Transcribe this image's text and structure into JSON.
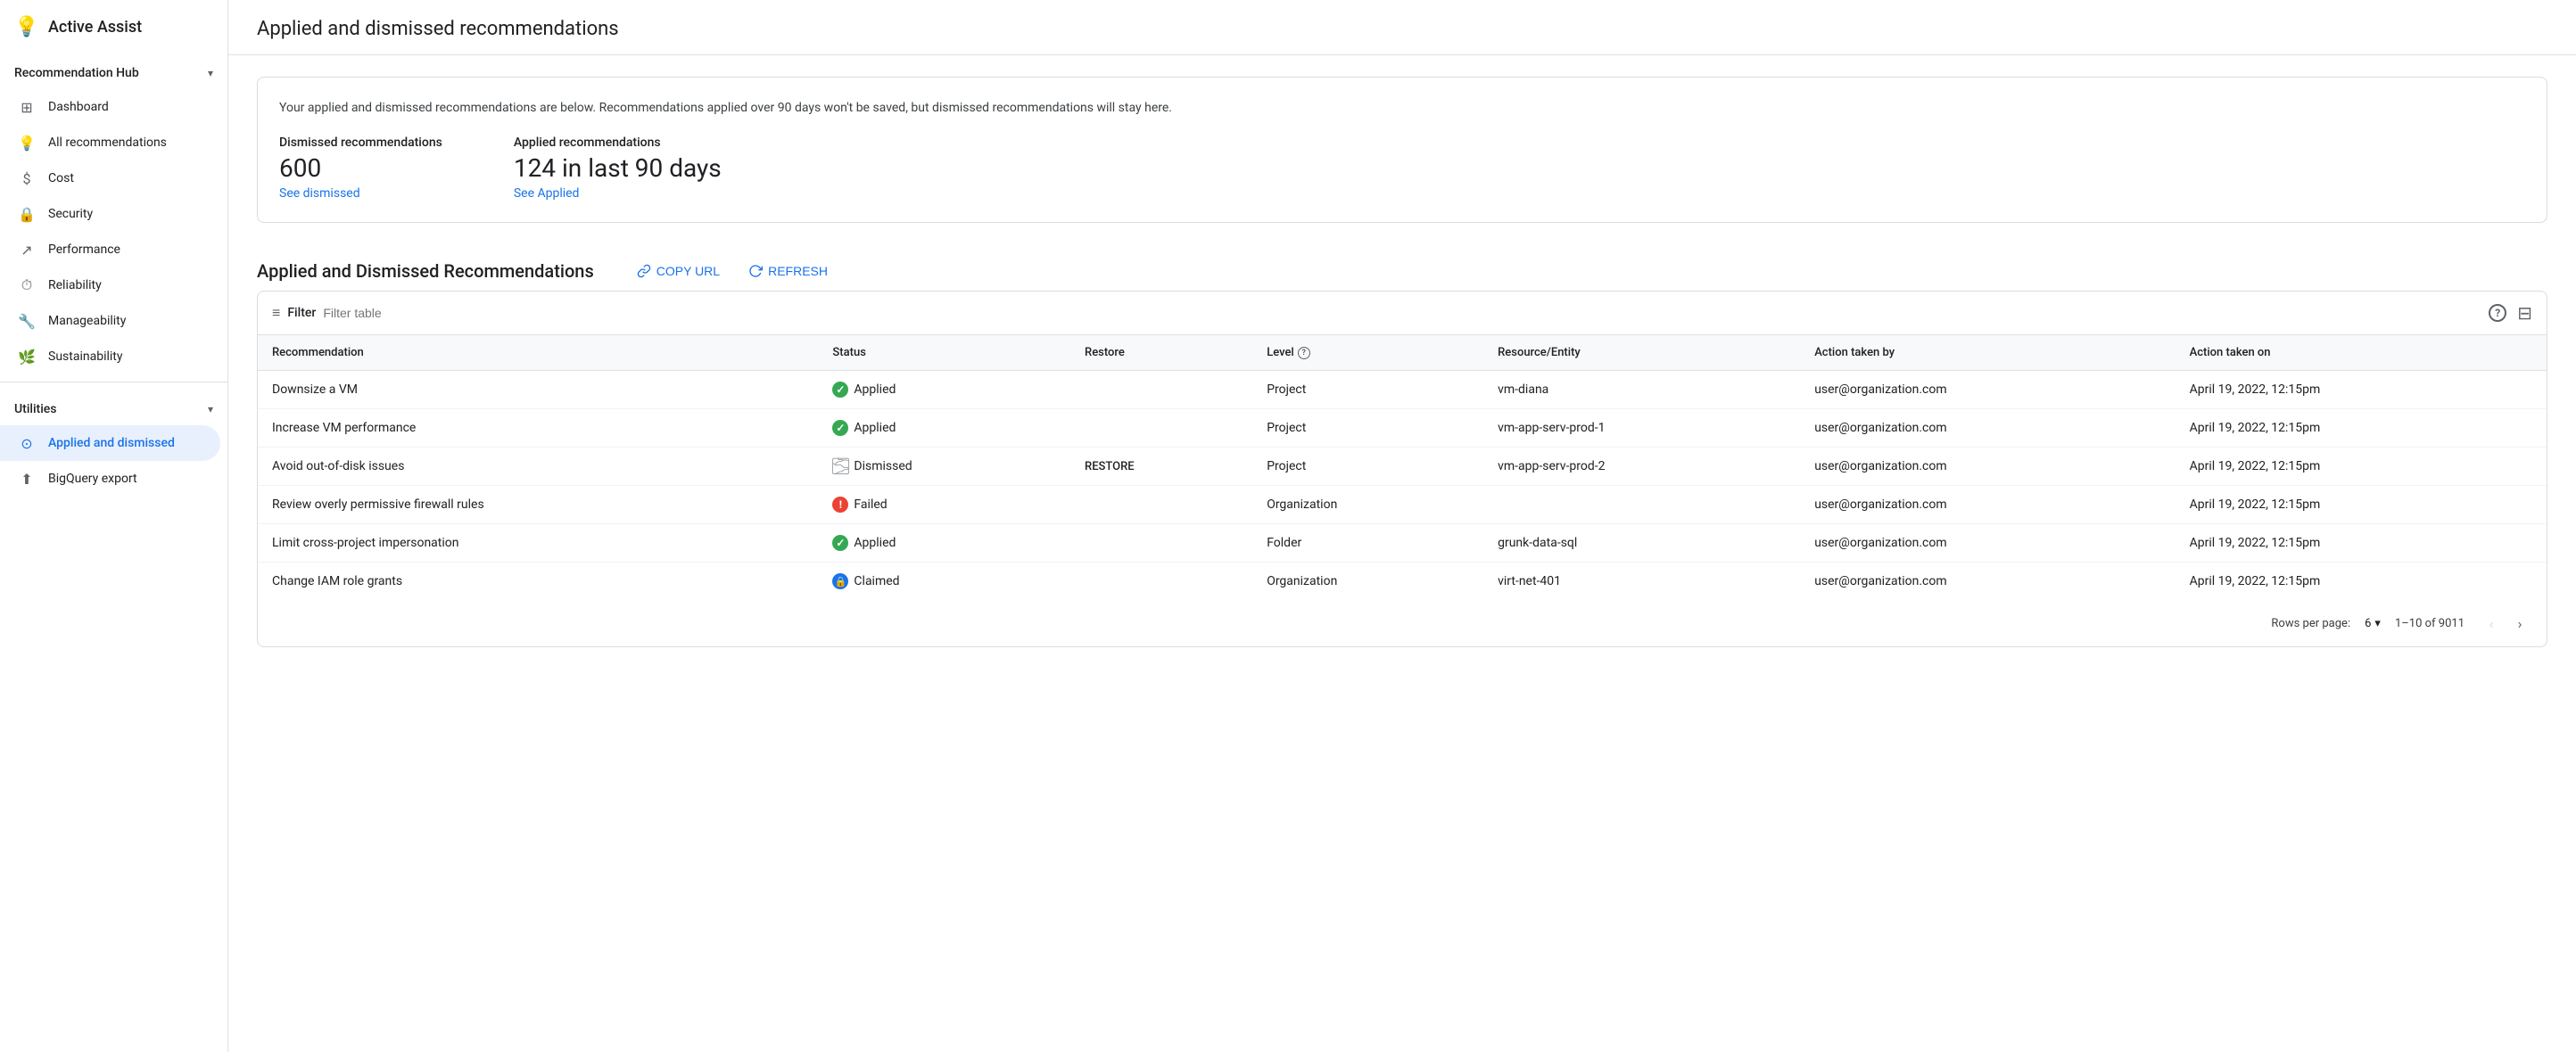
{
  "sidebar": {
    "logo_symbol": "💡",
    "title": "Active Assist",
    "recommendation_hub_label": "Recommendation Hub",
    "chevron": "▾",
    "items": [
      {
        "id": "dashboard",
        "label": "Dashboard",
        "icon": "⊞"
      },
      {
        "id": "all-recommendations",
        "label": "All recommendations",
        "icon": "💡"
      },
      {
        "id": "cost",
        "label": "Cost",
        "icon": "$"
      },
      {
        "id": "security",
        "label": "Security",
        "icon": "🔒"
      },
      {
        "id": "performance",
        "label": "Performance",
        "icon": "↗"
      },
      {
        "id": "reliability",
        "label": "Reliability",
        "icon": "⏱"
      },
      {
        "id": "manageability",
        "label": "Manageability",
        "icon": "🔧"
      },
      {
        "id": "sustainability",
        "label": "Sustainability",
        "icon": "🌿"
      }
    ],
    "utilities_label": "Utilities",
    "utilities_chevron": "▾",
    "utility_items": [
      {
        "id": "applied-dismissed",
        "label": "Applied and dismissed",
        "icon": "⊙",
        "active": true
      },
      {
        "id": "bigquery-export",
        "label": "BigQuery export",
        "icon": "⬆"
      }
    ]
  },
  "main": {
    "page_title": "Applied and dismissed recommendations",
    "info_text": "Your applied and dismissed recommendations are below. Recommendations applied over 90 days won't be saved, but dismissed recommendations will stay here.",
    "dismissed_label": "Dismissed recommendations",
    "dismissed_count": "600",
    "see_dismissed_link": "See dismissed",
    "applied_label": "Applied recommendations",
    "applied_count": "124 in last 90 days",
    "see_applied_link": "See Applied",
    "section_title": "Applied and Dismissed Recommendations",
    "copy_url_label": "COPY URL",
    "refresh_label": "REFRESH",
    "filter_label": "Filter",
    "filter_placeholder": "Filter table",
    "table": {
      "columns": [
        {
          "id": "recommendation",
          "label": "Recommendation"
        },
        {
          "id": "status",
          "label": "Status"
        },
        {
          "id": "restore",
          "label": "Restore"
        },
        {
          "id": "level",
          "label": "Level",
          "has_help": true
        },
        {
          "id": "resource",
          "label": "Resource/Entity"
        },
        {
          "id": "action_by",
          "label": "Action taken by"
        },
        {
          "id": "action_on",
          "label": "Action taken on"
        }
      ],
      "rows": [
        {
          "recommendation": "Downsize a VM",
          "status": "Applied",
          "status_type": "applied",
          "restore": "",
          "level": "Project",
          "resource": "vm-diana",
          "action_by": "user@organization.com",
          "action_on": "April 19, 2022, 12:15pm"
        },
        {
          "recommendation": "Increase VM performance",
          "status": "Applied",
          "status_type": "applied",
          "restore": "",
          "level": "Project",
          "resource": "vm-app-serv-prod-1",
          "action_by": "user@organization.com",
          "action_on": "April 19, 2022, 12:15pm"
        },
        {
          "recommendation": "Avoid out-of-disk issues",
          "status": "Dismissed",
          "status_type": "dismissed",
          "restore": "RESTORE",
          "level": "Project",
          "resource": "vm-app-serv-prod-2",
          "action_by": "user@organization.com",
          "action_on": "April 19, 2022, 12:15pm"
        },
        {
          "recommendation": "Review overly permissive firewall rules",
          "status": "Failed",
          "status_type": "failed",
          "restore": "",
          "level": "Organization",
          "resource": "",
          "action_by": "user@organization.com",
          "action_on": "April 19, 2022, 12:15pm"
        },
        {
          "recommendation": "Limit cross-project impersonation",
          "status": "Applied",
          "status_type": "applied",
          "restore": "",
          "level": "Folder",
          "resource": "grunk-data-sql",
          "action_by": "user@organization.com",
          "action_on": "April 19, 2022, 12:15pm"
        },
        {
          "recommendation": "Change IAM role grants",
          "status": "Claimed",
          "status_type": "claimed",
          "restore": "",
          "level": "Organization",
          "resource": "virt-net-401",
          "action_by": "user@organization.com",
          "action_on": "April 19, 2022, 12:15pm"
        }
      ]
    },
    "pagination": {
      "rows_per_page_label": "Rows per page:",
      "rows_per_page_value": "6",
      "page_info": "1–10 of 9011"
    }
  }
}
